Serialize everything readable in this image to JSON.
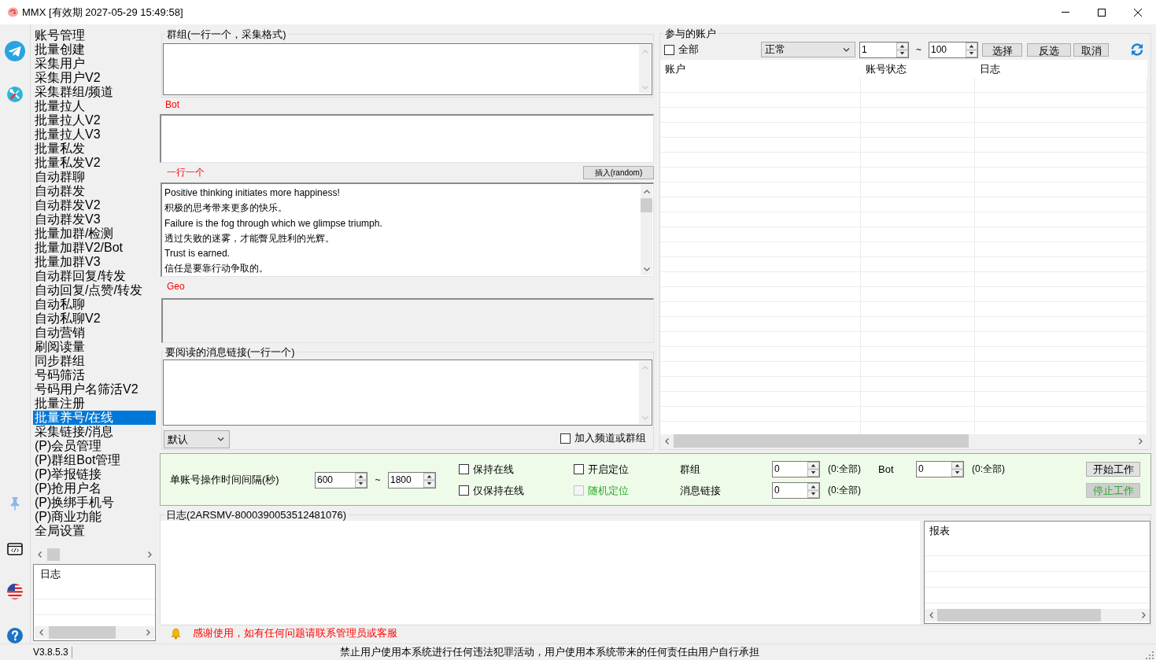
{
  "window": {
    "title": "MMX [有效期 2027-05-29 15:49:58]"
  },
  "sidebar": {
    "items": [
      {
        "label": "账号管理",
        "selected": false
      },
      {
        "label": "批量创建",
        "selected": false
      },
      {
        "label": "采集用户",
        "selected": false
      },
      {
        "label": "采集用户V2",
        "selected": false
      },
      {
        "label": "采集群组/频道",
        "selected": false
      },
      {
        "label": "批量拉人",
        "selected": false
      },
      {
        "label": "批量拉人V2",
        "selected": false
      },
      {
        "label": "批量拉人V3",
        "selected": false
      },
      {
        "label": "批量私发",
        "selected": false
      },
      {
        "label": "批量私发V2",
        "selected": false
      },
      {
        "label": "自动群聊",
        "selected": false
      },
      {
        "label": "自动群发",
        "selected": false
      },
      {
        "label": "自动群发V2",
        "selected": false
      },
      {
        "label": "自动群发V3",
        "selected": false
      },
      {
        "label": "批量加群/检测",
        "selected": false
      },
      {
        "label": "批量加群V2/Bot",
        "selected": false
      },
      {
        "label": "批量加群V3",
        "selected": false
      },
      {
        "label": "自动群回复/转发",
        "selected": false
      },
      {
        "label": "自动回复/点赞/转发",
        "selected": false
      },
      {
        "label": "自动私聊",
        "selected": false
      },
      {
        "label": "自动私聊V2",
        "selected": false
      },
      {
        "label": "自动营销",
        "selected": false
      },
      {
        "label": "刷阅读量",
        "selected": false
      },
      {
        "label": "同步群组",
        "selected": false
      },
      {
        "label": "号码筛活",
        "selected": false
      },
      {
        "label": "号码用户名筛活V2",
        "selected": false
      },
      {
        "label": "批量注册",
        "selected": false
      },
      {
        "label": "批量养号/在线",
        "selected": true
      },
      {
        "label": "采集链接/消息",
        "selected": false
      },
      {
        "label": "(P)会员管理",
        "selected": false
      },
      {
        "label": "(P)群组Bot管理",
        "selected": false
      },
      {
        "label": "(P)举报链接",
        "selected": false
      },
      {
        "label": "(P)抢用户名",
        "selected": false
      },
      {
        "label": "(P)换绑手机号",
        "selected": false
      },
      {
        "label": "(P)商业功能",
        "selected": false
      },
      {
        "label": "全局设置",
        "selected": false
      }
    ]
  },
  "sidebar_log": {
    "columns": [
      "日志"
    ]
  },
  "groups_input": {
    "title": "群组(一行一个，采集格式)"
  },
  "bot_input": {
    "label": "Bot"
  },
  "messages": {
    "label": "一行一个",
    "insert_button": "插入(random)",
    "lines": [
      "Positive thinking initiates more happiness!",
      "积极的思考带来更多的快乐。",
      "Failure is the fog through which we glimpse triumph.",
      "透过失败的迷雾，才能瞥见胜利的光辉。",
      "Trust is earned.",
      "信任是要靠行动争取的。"
    ]
  },
  "geo_input": {
    "label": "Geo",
    "disabled": true
  },
  "read_links": {
    "title": "要阅读的消息链接(一行一个)",
    "mode": "默认",
    "join": {
      "label": "加入频道或群组",
      "checked": false
    }
  },
  "accounts": {
    "title": "参与的账户",
    "select_all": {
      "label": "全部",
      "checked": false
    },
    "status_filter": "正常",
    "range_from": "1",
    "range_separator": "~",
    "range_to": "100",
    "buttons": [
      "选择",
      "反选",
      "取消"
    ],
    "table": {
      "columns": [
        "账户",
        "账号状态",
        "日志"
      ]
    }
  },
  "settings": {
    "interval_label": "单账号操作时间间隔(秒)",
    "interval_from": "600",
    "interval_separator": "~",
    "interval_to": "1800",
    "checkboxes": [
      {
        "label": "保持在线",
        "checked": false,
        "disabled": false
      },
      {
        "label": "仅保持在线",
        "checked": false,
        "disabled": false
      },
      {
        "label": "开启定位",
        "checked": false,
        "disabled": false
      },
      {
        "label": "随机定位",
        "checked": false,
        "disabled": true
      }
    ],
    "limits": [
      {
        "label": "群组",
        "value": "0",
        "hint": "(0:全部)"
      },
      {
        "label": "消息链接",
        "value": "0",
        "hint": "(0:全部)"
      },
      {
        "label": "Bot",
        "value": "0",
        "hint": "(0:全部)"
      }
    ],
    "buttons": [
      {
        "label": "开始工作",
        "disabled": false
      },
      {
        "label": "停止工作",
        "disabled": true
      }
    ]
  },
  "log": {
    "title": "日志(2ARSMV-8000390053512481076)",
    "report": {
      "columns": [
        "报表"
      ]
    }
  },
  "notice": "感谢使用，如有任何问题请联系管理员或客服",
  "status_bar": {
    "version": "V3.8.5.3",
    "message": "禁止用户使用本系统进行任何违法犯罪活动，用户使用本系统带来的任何责任由用户自行承担"
  }
}
